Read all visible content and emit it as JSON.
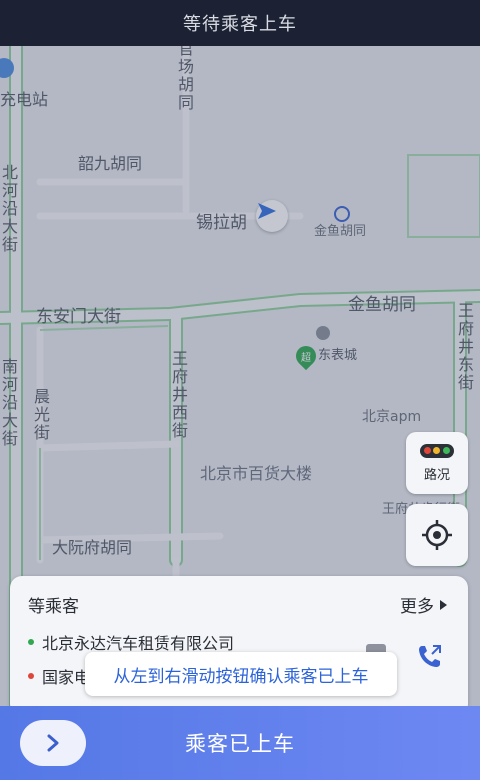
{
  "header": {
    "title": "等待乘客上车"
  },
  "map": {
    "labels": {
      "charging_station": "充电站",
      "shaojiu": "韶九胡同",
      "xila": "锡拉胡",
      "jinyu_small": "金鱼胡同",
      "dongan": "东安门大街",
      "jinyu_big": "金鱼胡同",
      "bj_apm": "北京apm",
      "dept_store": "北京市百货大楼",
      "dayuan": "大阮府胡同",
      "wangfujing_st": "王府井步行街",
      "dongbiao": "东表城"
    },
    "vertical_labels": {
      "guanchang": "官场胡同",
      "beiheyan": "北河沿大街",
      "nanheyan": "南河沿大街",
      "chenguang": "晨光街",
      "wangfujing_west": "王府井西街",
      "wangfujing_east": "王府井东街"
    },
    "poi_badge": "超"
  },
  "controls": {
    "traffic_label": "路况",
    "traffic_colors": [
      "#e0453a",
      "#f2b62c",
      "#3fb85a"
    ]
  },
  "card": {
    "title": "等乘客",
    "more_label": "更多",
    "start": {
      "text": "北京永达汽车租赁有限公司",
      "color": "#2fa84f"
    },
    "end": {
      "text": "国家电",
      "color": "#e0453a"
    }
  },
  "tooltip": {
    "text": "从左到右滑动按钮确认乘客已上车"
  },
  "bottom": {
    "confirm_label": "乘客已上车"
  },
  "colors": {
    "accent": "#5a7ce8",
    "route": "#8fd19a"
  }
}
